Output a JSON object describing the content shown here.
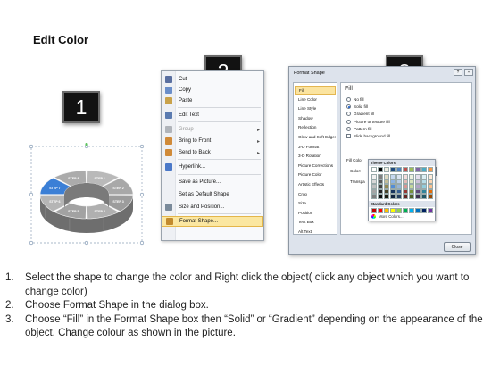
{
  "title": "Edit Color",
  "badges": [
    "1",
    "2",
    "3"
  ],
  "ring": {
    "segments": [
      "STEP 1",
      "STEP 2",
      "STEP 3",
      "STEP 4",
      "STEP 5",
      "STEP 6",
      "STEP 7",
      "STEP 8"
    ],
    "highlight_color": "#3b7fd6",
    "base_color": "#9a9a9a"
  },
  "context_menu": {
    "items": [
      {
        "label": "Cut",
        "icon": "scissors-icon",
        "disabled": false,
        "submenu": false
      },
      {
        "label": "Copy",
        "icon": "copy-icon",
        "disabled": false,
        "submenu": false
      },
      {
        "label": "Paste",
        "icon": "paste-icon",
        "disabled": false,
        "submenu": false
      },
      {
        "label": "Edit Text",
        "icon": "edit-text-icon",
        "disabled": false,
        "submenu": false
      },
      {
        "label": "Group",
        "icon": "group-icon",
        "disabled": true,
        "submenu": true
      },
      {
        "label": "Bring to Front",
        "icon": "bring-front-icon",
        "disabled": false,
        "submenu": true
      },
      {
        "label": "Send to Back",
        "icon": "send-back-icon",
        "disabled": false,
        "submenu": true
      },
      {
        "label": "Hyperlink...",
        "icon": "hyperlink-icon",
        "disabled": false,
        "submenu": false
      },
      {
        "label": "Save as Picture...",
        "icon": "",
        "disabled": false,
        "submenu": false
      },
      {
        "label": "Set as Default Shape",
        "icon": "",
        "disabled": false,
        "submenu": false
      },
      {
        "label": "Size and Position...",
        "icon": "size-icon",
        "disabled": false,
        "submenu": false
      },
      {
        "label": "Format Shape...",
        "icon": "format-shape-icon",
        "disabled": false,
        "submenu": false,
        "highlighted": true
      }
    ]
  },
  "dialog": {
    "title": "Format Shape",
    "nav": [
      "Fill",
      "Line Color",
      "Line Style",
      "Shadow",
      "Reflection",
      "Glow and Soft Edges",
      "3-D Format",
      "3-D Rotation",
      "Picture Corrections",
      "Picture Color",
      "Artistic Effects",
      "Crop",
      "Size",
      "Position",
      "Text Box",
      "Alt Text"
    ],
    "nav_selected": "Fill",
    "pane_title": "Fill",
    "options": [
      {
        "label": "No fill",
        "type": "radio",
        "checked": false
      },
      {
        "label": "Solid fill",
        "type": "radio",
        "checked": true
      },
      {
        "label": "Gradient fill",
        "type": "radio",
        "checked": false
      },
      {
        "label": "Picture or texture fill",
        "type": "radio",
        "checked": false
      },
      {
        "label": "Pattern fill",
        "type": "radio",
        "checked": false
      },
      {
        "label": "Slide background fill",
        "type": "check",
        "checked": false
      }
    ],
    "fill_color_label": "Fill Color",
    "color_label": "Color:",
    "transparency_label": "Transpa",
    "close_label": "Close",
    "selected_color": "#2f6ecb"
  },
  "palette": {
    "theme_label": "Theme Colors",
    "standard_label": "Standard Colors",
    "more_label": "More Colors...",
    "theme_top": [
      "#ffffff",
      "#000000",
      "#eeece1",
      "#1f497d",
      "#4f81bd",
      "#c0504d",
      "#9bbb59",
      "#8064a2",
      "#4bacc6",
      "#f79646"
    ],
    "theme_shades": [
      [
        "#f2f2f2",
        "#7f7f7f",
        "#ddd9c3",
        "#c6d9f0",
        "#dbe5f1",
        "#f2dcdb",
        "#ebf1dd",
        "#e5e0ec",
        "#dbeef3",
        "#fdeada"
      ],
      [
        "#d8d8d8",
        "#595959",
        "#c4bd97",
        "#8db3e2",
        "#b8cce4",
        "#e5b9b7",
        "#d7e3bc",
        "#ccc1d9",
        "#b7dde8",
        "#fbd5b5"
      ],
      [
        "#bfbfbf",
        "#3f3f3f",
        "#938953",
        "#548dd4",
        "#95b3d7",
        "#d99694",
        "#c3d69b",
        "#b2a2c7",
        "#92cddc",
        "#fac08f"
      ],
      [
        "#a5a5a5",
        "#262626",
        "#494429",
        "#17365d",
        "#366092",
        "#953734",
        "#76923c",
        "#5f497a",
        "#31859b",
        "#e36c09"
      ],
      [
        "#7f7f7f",
        "#0c0c0c",
        "#1d1b10",
        "#0f243e",
        "#244061",
        "#632423",
        "#4f6128",
        "#3f3151",
        "#205867",
        "#974806"
      ]
    ],
    "standard": [
      "#c00000",
      "#ff0000",
      "#ffc000",
      "#ffff00",
      "#92d050",
      "#00b050",
      "#00b0f0",
      "#0070c0",
      "#002060",
      "#7030a0"
    ]
  },
  "instructions": [
    {
      "num": "1.",
      "text": "Select the shape to change the color and Right click the object( click any object which you want to change color)"
    },
    {
      "num": "2.",
      "text": "Choose Format Shape in the dialog box."
    },
    {
      "num": "3.",
      "text": "Choose “Fill” in the Format Shape box then “Solid” or “Gradient” depending on the appearance of the object. Change colour as shown in the picture."
    }
  ]
}
